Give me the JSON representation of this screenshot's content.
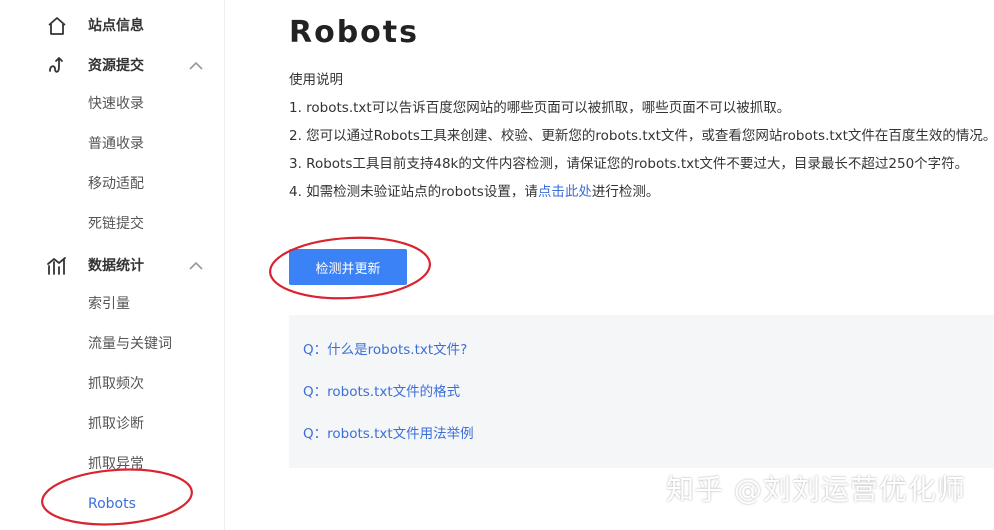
{
  "sidebar": {
    "groups": [
      {
        "label": "站点信息",
        "icon": "home-icon"
      },
      {
        "label": "资源提交",
        "icon": "submit-icon",
        "expanded": true,
        "items": [
          "快速收录",
          "普通收录",
          "移动适配",
          "死链提交"
        ]
      },
      {
        "label": "数据统计",
        "icon": "chart-icon",
        "expanded": true,
        "items": [
          "索引量",
          "流量与关键词",
          "抓取频次",
          "抓取诊断",
          "抓取异常",
          "Robots"
        ]
      }
    ],
    "active_item": "Robots"
  },
  "main": {
    "title": "Robots",
    "usage_heading": "使用说明",
    "lines": [
      "1. robots.txt可以告诉百度您网站的哪些页面可以被抓取，哪些页面不可以被抓取。",
      "2. 您可以通过Robots工具来创建、校验、更新您的robots.txt文件，或查看您网站robots.txt文件在百度生效的情况。",
      "3. Robots工具目前支持48k的文件内容检测，请保证您的robots.txt文件不要过大，目录最长不超过250个字符。"
    ],
    "line4_prefix": "4. 如需检测未验证站点的robots设置，请",
    "line4_link": "点击此处",
    "line4_suffix": "进行检测。",
    "check_button": "检测并更新",
    "faq": [
      "Q：什么是robots.txt文件?",
      "Q：robots.txt文件的格式",
      "Q：robots.txt文件用法举例"
    ]
  },
  "watermark": "知乎 @刘刘运营优化师",
  "colors": {
    "accent": "#3b82f6",
    "link": "#3b6fd8",
    "annotation": "#d9232e"
  }
}
